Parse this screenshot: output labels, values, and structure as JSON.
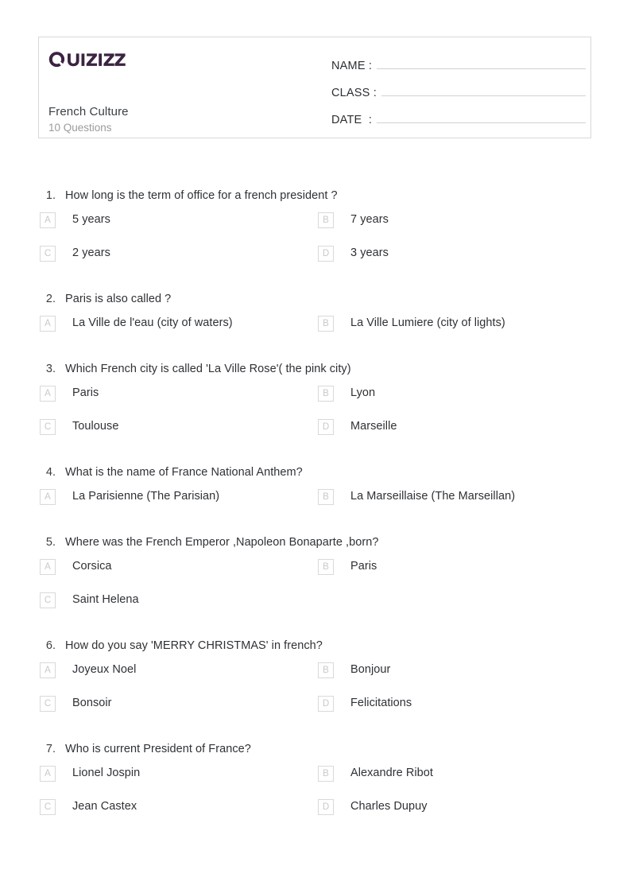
{
  "brand": {
    "name": "Quizizz",
    "logo_color": "#3b2341"
  },
  "header": {
    "quiz_title": "French Culture",
    "question_count_label": "10 Questions",
    "fields": [
      {
        "label": "NAME :",
        "value": ""
      },
      {
        "label": "CLASS :",
        "value": ""
      },
      {
        "label": "DATE  :",
        "value": ""
      }
    ]
  },
  "questions": [
    {
      "number": "1.",
      "text": "How long is the term of office for a french president ?",
      "options": [
        {
          "letter": "A",
          "text": "5 years"
        },
        {
          "letter": "B",
          "text": "7 years"
        },
        {
          "letter": "C",
          "text": "2 years"
        },
        {
          "letter": "D",
          "text": "3 years"
        }
      ]
    },
    {
      "number": "2.",
      "text": "Paris is also called ?",
      "options": [
        {
          "letter": "A",
          "text": "La Ville de l'eau (city of waters)"
        },
        {
          "letter": "B",
          "text": "La Ville Lumiere (city of lights)"
        }
      ]
    },
    {
      "number": "3.",
      "text": "Which French city is called 'La Ville Rose'( the pink city)",
      "options": [
        {
          "letter": "A",
          "text": "Paris"
        },
        {
          "letter": "B",
          "text": "Lyon"
        },
        {
          "letter": "C",
          "text": "Toulouse"
        },
        {
          "letter": "D",
          "text": "Marseille"
        }
      ]
    },
    {
      "number": "4.",
      "text": "What is the name of France National Anthem?",
      "options": [
        {
          "letter": "A",
          "text": "La Parisienne (The Parisian)"
        },
        {
          "letter": "B",
          "text": "La Marseillaise (The Marseillan)"
        }
      ]
    },
    {
      "number": "5.",
      "text": "Where was the French Emperor ,Napoleon Bonaparte ,born?",
      "options": [
        {
          "letter": "A",
          "text": "Corsica"
        },
        {
          "letter": "B",
          "text": "Paris"
        },
        {
          "letter": "C",
          "text": "Saint Helena"
        }
      ]
    },
    {
      "number": "6.",
      "text": "How do you say 'MERRY CHRISTMAS' in french?",
      "options": [
        {
          "letter": "A",
          "text": "Joyeux Noel"
        },
        {
          "letter": "B",
          "text": "Bonjour"
        },
        {
          "letter": "C",
          "text": "Bonsoir"
        },
        {
          "letter": "D",
          "text": "Felicitations"
        }
      ]
    },
    {
      "number": "7.",
      "text": "Who is current President of France?",
      "options": [
        {
          "letter": "A",
          "text": "Lionel Jospin"
        },
        {
          "letter": "B",
          "text": "Alexandre Ribot"
        },
        {
          "letter": "C",
          "text": "Jean Castex"
        },
        {
          "letter": "D",
          "text": "Charles Dupuy"
        }
      ]
    }
  ]
}
